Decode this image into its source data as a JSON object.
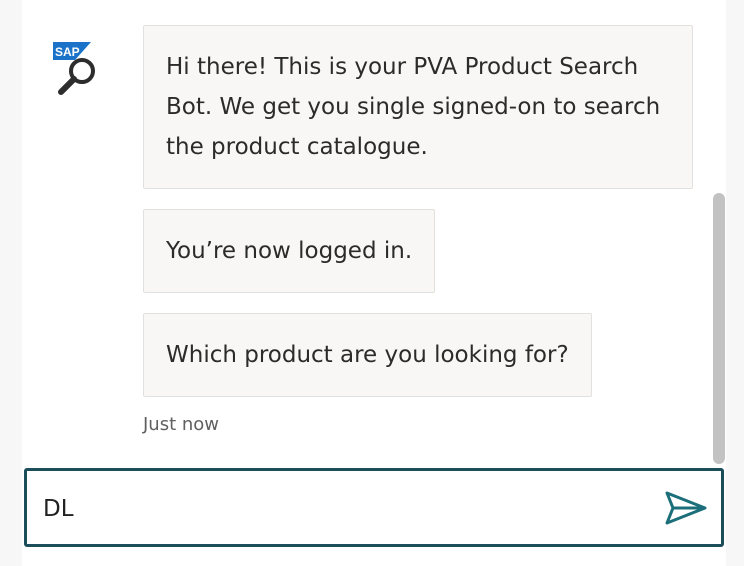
{
  "bot": {
    "avatar_icon": "sap-product-search-icon",
    "avatar_text": "SAP"
  },
  "messages": [
    {
      "text": "Hi there! This is your PVA Product Search Bot. We get you single signed-on to search the product catalogue."
    },
    {
      "text": "You’re now logged in."
    },
    {
      "text": "Which product are you looking for?"
    }
  ],
  "timestamp": "Just now",
  "composer": {
    "value": "DL",
    "send_icon": "send-icon"
  },
  "colors": {
    "bubble_bg": "#f8f7f5",
    "bubble_border": "#e3e1dd",
    "composer_border": "#1b4e5a",
    "send_icon": "#1b6f7a",
    "sap_blue": "#1a73c9"
  }
}
